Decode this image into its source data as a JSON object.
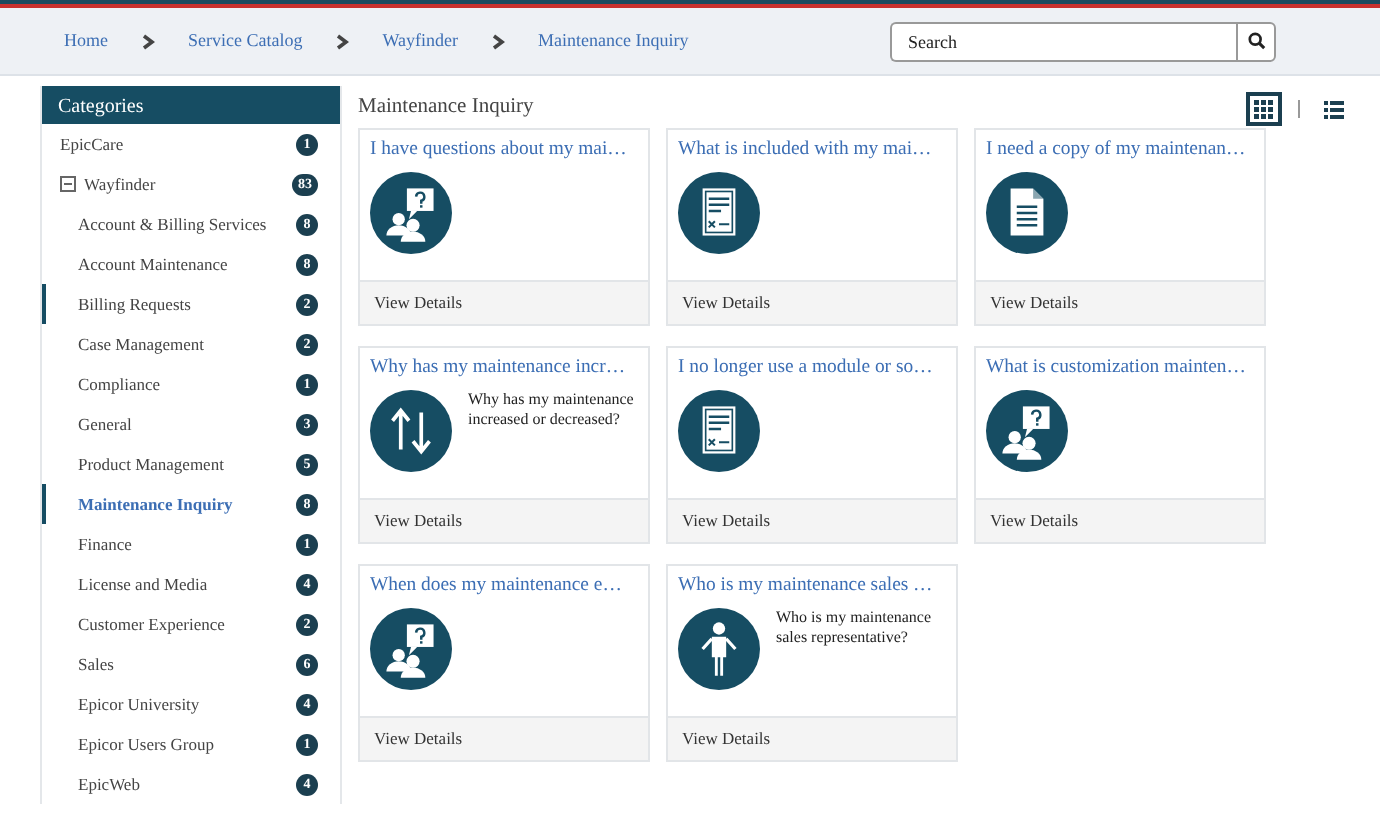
{
  "breadcrumb": [
    "Home",
    "Service Catalog",
    "Wayfinder",
    "Maintenance Inquiry"
  ],
  "search": {
    "placeholder": "Search"
  },
  "sidebar": {
    "title": "Categories",
    "items": [
      {
        "label": "EpicCare",
        "count": "1",
        "selected": false,
        "highlighted": false
      },
      {
        "label": "Wayfinder",
        "count": "83",
        "selected": false,
        "highlighted": false,
        "expanded": true,
        "children": [
          {
            "label": "Account & Billing Services",
            "count": "8",
            "selected": false,
            "highlighted": false
          },
          {
            "label": "Account Maintenance",
            "count": "8",
            "selected": false,
            "highlighted": false
          },
          {
            "label": "Billing Requests",
            "count": "2",
            "selected": false,
            "highlighted": true
          },
          {
            "label": "Case Management",
            "count": "2",
            "selected": false,
            "highlighted": false
          },
          {
            "label": "Compliance",
            "count": "1",
            "selected": false,
            "highlighted": false
          },
          {
            "label": "General",
            "count": "3",
            "selected": false,
            "highlighted": false
          },
          {
            "label": "Product Management",
            "count": "5",
            "selected": false,
            "highlighted": false
          },
          {
            "label": "Maintenance Inquiry",
            "count": "8",
            "selected": true,
            "highlighted": true
          },
          {
            "label": "Finance",
            "count": "1",
            "selected": false,
            "highlighted": false
          },
          {
            "label": "License and Media",
            "count": "4",
            "selected": false,
            "highlighted": false
          },
          {
            "label": "Customer Experience",
            "count": "2",
            "selected": false,
            "highlighted": false
          },
          {
            "label": "Sales",
            "count": "6",
            "selected": false,
            "highlighted": false
          },
          {
            "label": "Epicor University",
            "count": "4",
            "selected": false,
            "highlighted": false
          },
          {
            "label": "Epicor Users Group",
            "count": "1",
            "selected": false,
            "highlighted": false
          },
          {
            "label": "EpicWeb",
            "count": "4",
            "selected": false,
            "highlighted": false
          }
        ]
      }
    ]
  },
  "main": {
    "title": "Maintenance Inquiry",
    "view_modes": [
      {
        "kind": "grid",
        "selected": true
      },
      {
        "kind": "list",
        "selected": false
      }
    ],
    "cards": [
      {
        "title": "I have questions about my mai…",
        "kind": "question",
        "link": "View Details"
      },
      {
        "title": "What is included with my mai…",
        "kind": "form",
        "link": "View Details"
      },
      {
        "title": "I need a copy of my maintenan…",
        "kind": "document",
        "link": "View Details"
      },
      {
        "title": "Why has my maintenance incr…",
        "kind": "arrows",
        "description": "Why has my maintenance increased or decreased?",
        "link": "View Details"
      },
      {
        "title": "I no longer use a module or so…",
        "kind": "form",
        "link": "View Details"
      },
      {
        "title": "What is customization mainten…",
        "kind": "question",
        "link": "View Details"
      },
      {
        "title": "When does my maintenance e…",
        "kind": "question",
        "link": "View Details"
      },
      {
        "title": "Who is my maintenance sales …",
        "kind": "person",
        "description": "Who is my maintenance sales representative?",
        "link": "View Details"
      }
    ]
  }
}
